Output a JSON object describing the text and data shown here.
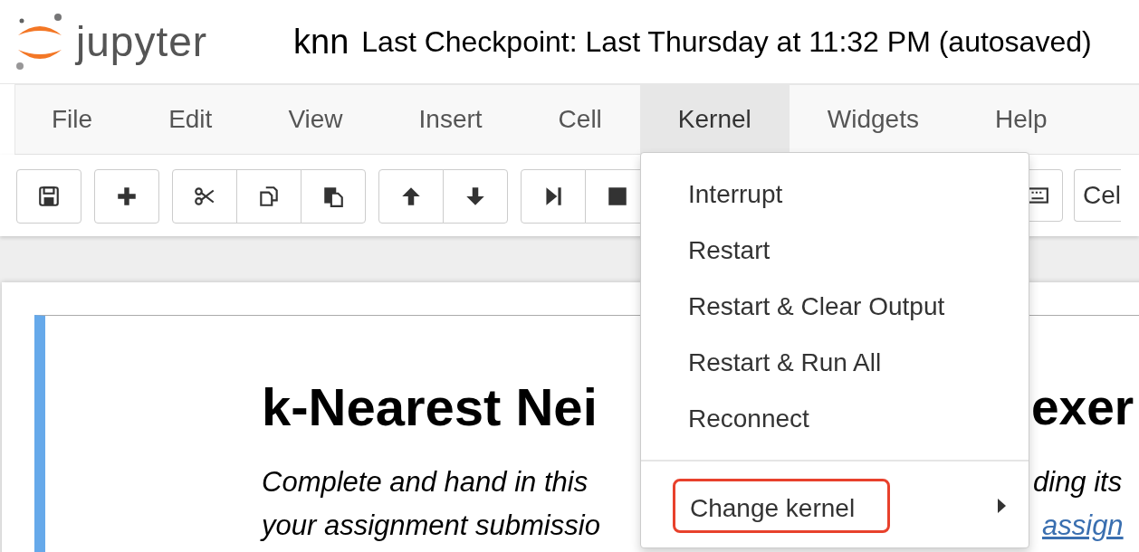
{
  "header": {
    "logo_text": "jupyter",
    "notebook_name": "knn",
    "checkpoint": "Last Checkpoint: Last Thursday at 11:32 PM (autosaved)"
  },
  "menubar": [
    {
      "label": "File",
      "selected": false
    },
    {
      "label": "Edit",
      "selected": false
    },
    {
      "label": "View",
      "selected": false
    },
    {
      "label": "Insert",
      "selected": false
    },
    {
      "label": "Cell",
      "selected": false
    },
    {
      "label": "Kernel",
      "selected": true
    },
    {
      "label": "Widgets",
      "selected": false
    },
    {
      "label": "Help",
      "selected": false
    }
  ],
  "toolbar": {
    "groups": [
      [
        {
          "kind": "save"
        }
      ],
      [
        {
          "kind": "add"
        }
      ],
      [
        {
          "kind": "cut"
        },
        {
          "kind": "copy"
        },
        {
          "kind": "paste"
        }
      ],
      [
        {
          "kind": "up"
        },
        {
          "kind": "down"
        }
      ],
      [
        {
          "kind": "run"
        },
        {
          "kind": "stop"
        }
      ],
      [
        {
          "kind": "keyboard"
        }
      ]
    ],
    "cell_type": "Cel"
  },
  "kernel_menu": [
    {
      "kind": "item",
      "label": "Interrupt"
    },
    {
      "kind": "item",
      "label": "Restart"
    },
    {
      "kind": "item",
      "label": "Restart & Clear Output"
    },
    {
      "kind": "item",
      "label": "Restart & Run All"
    },
    {
      "kind": "item",
      "label": "Reconnect"
    },
    {
      "kind": "divider"
    },
    {
      "kind": "submenu",
      "label": "Change kernel",
      "outlined": true
    }
  ],
  "cell": {
    "heading": [
      "k-Nearest Nei",
      "exer"
    ],
    "lines": [
      [
        {
          "text": "Complete and hand in this",
          "link": false
        },
        {
          "text": "ding its",
          "link": false
        }
      ],
      [
        {
          "text": "your assignment submissio",
          "link": false
        },
        {
          "text": "assign",
          "link": true
        }
      ]
    ]
  }
}
